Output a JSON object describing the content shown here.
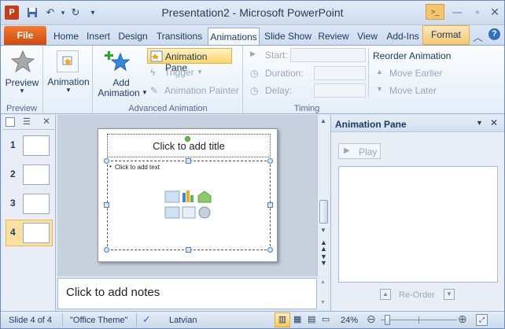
{
  "window": {
    "title": "Presentation2  -  Microsoft PowerPoint"
  },
  "tabs": [
    "File",
    "Home",
    "Insert",
    "Design",
    "Transitions",
    "Animations",
    "Slide Show",
    "Review",
    "View",
    "Add-Ins",
    "Format"
  ],
  "active_tab": "Animations",
  "ribbon": {
    "preview": {
      "label": "Preview",
      "group": "Preview"
    },
    "animation": {
      "label": "Animation"
    },
    "add_animation": {
      "line1": "Add",
      "line2": "Animation"
    },
    "animation_pane": "Animation Pane",
    "trigger": "Trigger",
    "animation_painter": "Animation Painter",
    "advanced_group": "Advanced Animation",
    "start": "Start:",
    "duration": "Duration:",
    "delay": "Delay:",
    "reorder": "Reorder Animation",
    "move_earlier": "Move Earlier",
    "move_later": "Move Later",
    "timing_group": "Timing"
  },
  "slides": [
    {
      "num": "1"
    },
    {
      "num": "2"
    },
    {
      "num": "3"
    },
    {
      "num": "4"
    }
  ],
  "selected_slide": 4,
  "slide": {
    "title_placeholder": "Click to add title",
    "content_placeholder": "Click to add text"
  },
  "notes_placeholder": "Click to add notes",
  "anim_pane": {
    "title": "Animation Pane",
    "play": "Play",
    "reorder": "Re-Order"
  },
  "status": {
    "slide": "Slide 4 of 4",
    "theme": "\"Office Theme\"",
    "language": "Latvian",
    "zoom": "24%",
    "zoom_level": 0.24
  },
  "colors": {
    "accent": "#d14a0c",
    "highlight": "#f9d873"
  }
}
